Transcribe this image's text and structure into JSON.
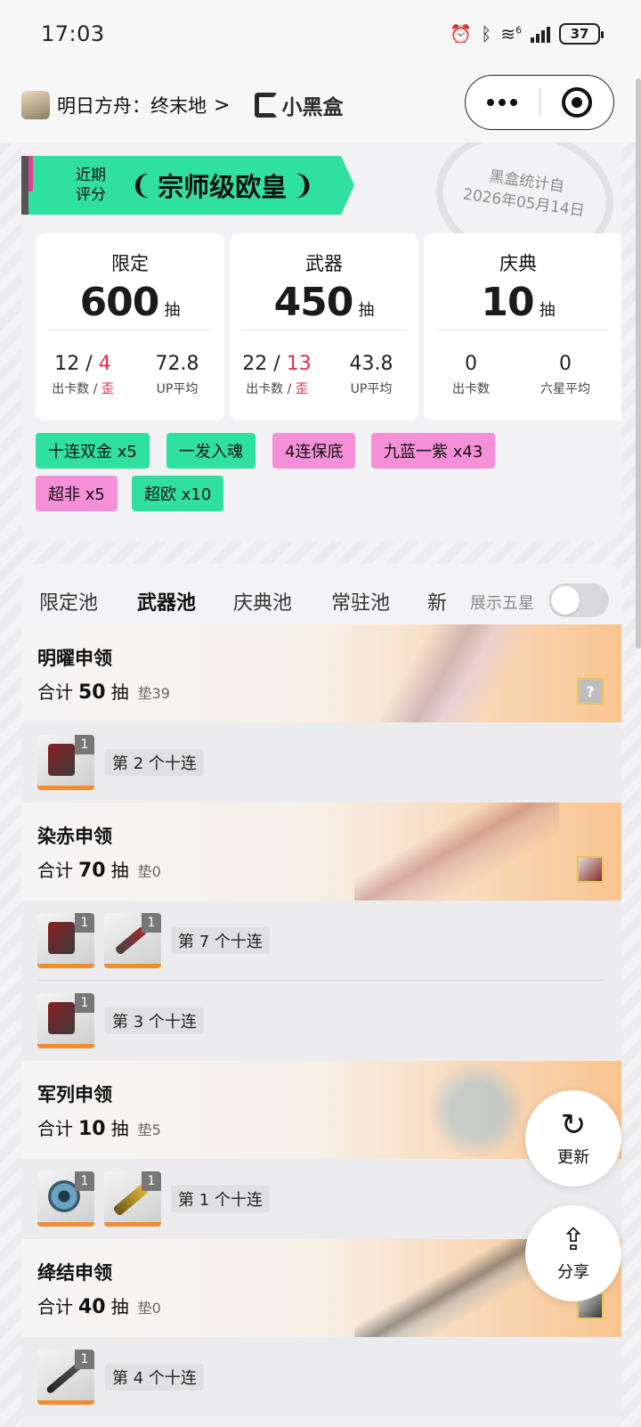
{
  "status": {
    "time": "17:03",
    "battery": "37",
    "network_badge": "6"
  },
  "nav": {
    "title": "明日方舟：终末地",
    "chevron": ">",
    "brand": "小黑盒"
  },
  "summary": {
    "stamp_line1": "黑盒统计自",
    "stamp_line2": "2026年05月14日",
    "rating_label_1": "近期",
    "rating_label_2": "评分",
    "rating_value": "宗师级欧皇",
    "laurel_left": "❨",
    "laurel_right": "❩",
    "cards": [
      {
        "title": "限定",
        "pulls": "600",
        "unit": "抽",
        "a_num1": "12",
        "a_slash": "/",
        "a_num2": "4",
        "a_lab1": "出卡数",
        "a_lab_slash": " / ",
        "a_lab2": "歪",
        "b_num": "72.8",
        "b_lab": "UP平均"
      },
      {
        "title": "武器",
        "pulls": "450",
        "unit": "抽",
        "a_num1": "22",
        "a_slash": "/",
        "a_num2": "13",
        "a_lab1": "出卡数",
        "a_lab_slash": " / ",
        "a_lab2": "歪",
        "b_num": "43.8",
        "b_lab": "UP平均"
      },
      {
        "title": "庆典",
        "pulls": "10",
        "unit": "抽",
        "a_num": "0",
        "a_lab": "出卡数",
        "b_num": "0",
        "b_lab": "六星平均"
      }
    ],
    "tags": [
      {
        "label": "十连双金 x5",
        "color": "#2fe0a0"
      },
      {
        "label": "一发入魂",
        "color": "#2fe0a0"
      },
      {
        "label": "4连保底",
        "color": "#f58fd8"
      },
      {
        "label": "九蓝一紫 x43",
        "color": "#f58fd8"
      },
      {
        "label": "超非 x5",
        "color": "#f58fd8"
      },
      {
        "label": "超欧 x10",
        "color": "#2fe0a0"
      }
    ]
  },
  "tabs": {
    "items": [
      "限定池",
      "武器池",
      "庆典池",
      "常驻池",
      "新"
    ],
    "active": "武器池",
    "toggle_label": "展示五星",
    "toggle_on": false
  },
  "pools": [
    {
      "name": "明曜申领",
      "total_prefix": "合计",
      "total": "50",
      "unit": "抽",
      "pity": "垫39",
      "thumb": "?",
      "rows": [
        {
          "label": "第 2 个十连",
          "items": [
            {
              "count": "1",
              "icon": "red-gun-icon"
            }
          ]
        }
      ]
    },
    {
      "name": "染赤申领",
      "total_prefix": "合计",
      "total": "70",
      "unit": "抽",
      "pity": "垫0",
      "thumb": "",
      "rows": [
        {
          "label": "第 7 个十连",
          "items": [
            {
              "count": "1",
              "icon": "red-gun-icon"
            },
            {
              "count": "1",
              "icon": "red-spear-icon"
            }
          ]
        },
        {
          "label": "第 3 个十连",
          "items": [
            {
              "count": "1",
              "icon": "red-gun-icon"
            }
          ]
        }
      ]
    },
    {
      "name": "军列申领",
      "total_prefix": "合计",
      "total": "10",
      "unit": "抽",
      "pity": "垫5",
      "thumb": "",
      "rows": [
        {
          "label": "第 1 个十连",
          "items": [
            {
              "count": "1",
              "icon": "blue-disc-icon"
            },
            {
              "count": "1",
              "icon": "gold-blade-icon"
            }
          ]
        }
      ]
    },
    {
      "name": "绛结申领",
      "total_prefix": "合计",
      "total": "40",
      "unit": "抽",
      "pity": "垫0",
      "thumb": "",
      "rows": [
        {
          "label": "第 4 个十连",
          "items": [
            {
              "count": "1",
              "icon": "black-sword-icon"
            }
          ]
        }
      ]
    }
  ],
  "fabs": {
    "refresh_icon": "↻",
    "refresh_label": "更新",
    "share_icon": "⇪",
    "share_label": "分享"
  }
}
